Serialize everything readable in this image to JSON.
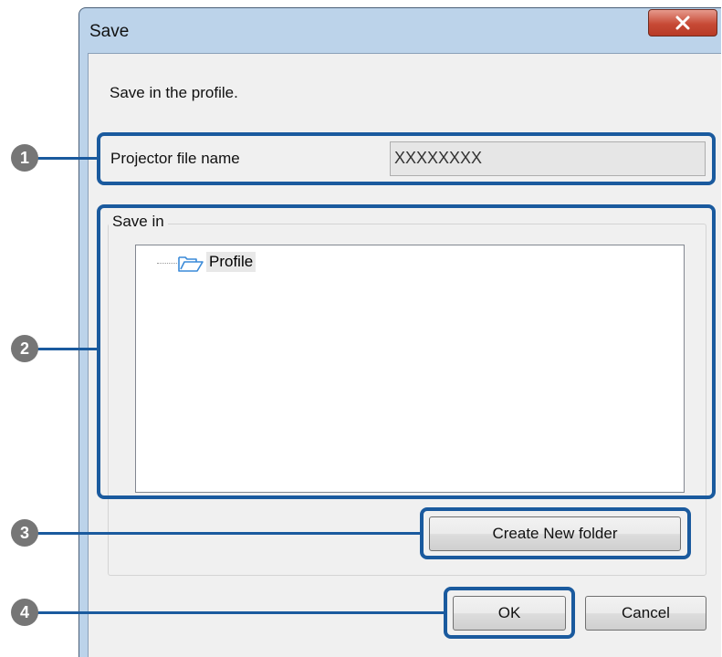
{
  "window": {
    "title": "Save"
  },
  "dialog": {
    "description": "Save in the profile.",
    "projector_file_name_label": "Projector file name",
    "projector_file_name_value": "XXXXXXXX",
    "save_in_label": "Save in",
    "tree_items": [
      {
        "label": "Profile",
        "icon": "folder-icon"
      }
    ],
    "create_folder_button": "Create New folder",
    "ok_button": "OK",
    "cancel_button": "Cancel"
  },
  "callouts": [
    {
      "number": "1"
    },
    {
      "number": "2"
    },
    {
      "number": "3"
    },
    {
      "number": "4"
    }
  ],
  "colors": {
    "callout_outline": "#1a5a9e",
    "callout_circle": "#767676",
    "close_button": "#c74a36",
    "title_bar": "#bcd3ea",
    "dialog_background": "#f0f0f0"
  }
}
